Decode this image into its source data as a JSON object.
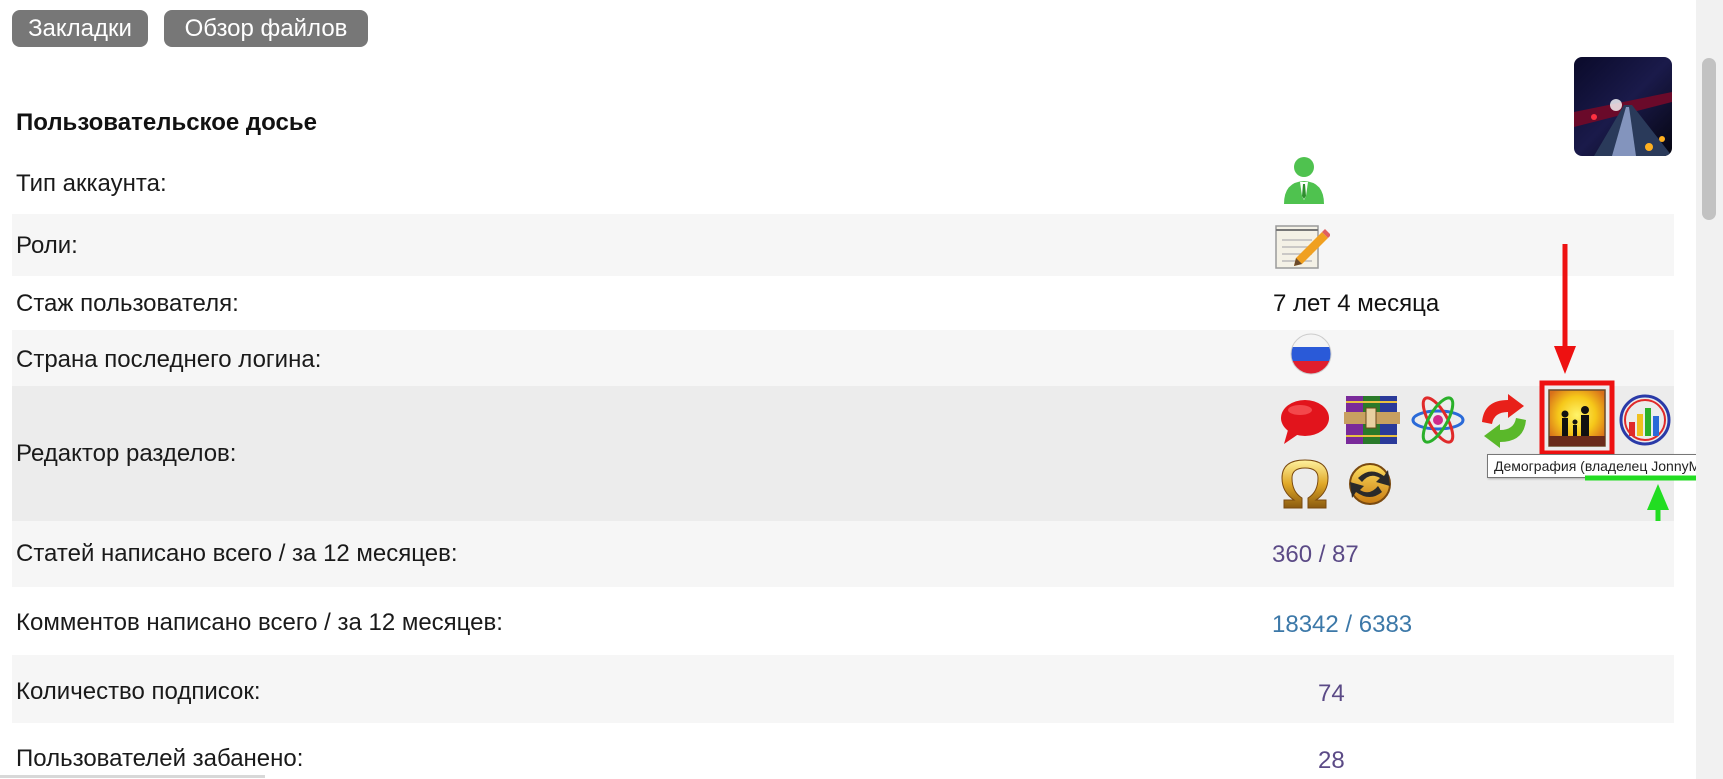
{
  "nav": {
    "bookmarks": "Закладки",
    "file_browser": "Обзор файлов"
  },
  "dossier": {
    "title": "Пользовательское досье",
    "account_type_label": "Тип аккаунта:",
    "account_type_icon": "user-account-icon",
    "roles_label": "Роли:",
    "roles_icon": "notepad-pencil-icon",
    "tenure_label": "Стаж пользователя:",
    "tenure_value": "7 лет 4 месяца",
    "last_country_label": "Страна последнего логина:",
    "last_country_icon": "russia-flag-icon",
    "section_editor_label": "Редактор разделов:",
    "section_icons": [
      "speech-bubble-icon",
      "winrar-books-icon",
      "atom-icon",
      "refresh-arrows-icon",
      "demography-family-icon",
      "bar-chart-globe-icon",
      "omega-icon",
      "gold-arrows-icon"
    ],
    "articles_label": "Статей написано всего / за 12 месяцев:",
    "articles_value": "360 / 87",
    "comments_label": "Комментов написано всего / за 12 месяцев:",
    "comments_value": "18342 / 6383",
    "subscriptions_label": "Количество подписок:",
    "subscriptions_value": "74",
    "banned_label": "Пользователей забанено:",
    "banned_value": "28"
  },
  "tooltip": {
    "text": "Демография (владелец JonnyMSB)"
  },
  "colors": {
    "button_bg": "#777777",
    "link_purple": "#5b4a86",
    "link_blue": "#3c78a8",
    "highlight_red": "#ee1111",
    "annotation_green": "#22dd22"
  }
}
